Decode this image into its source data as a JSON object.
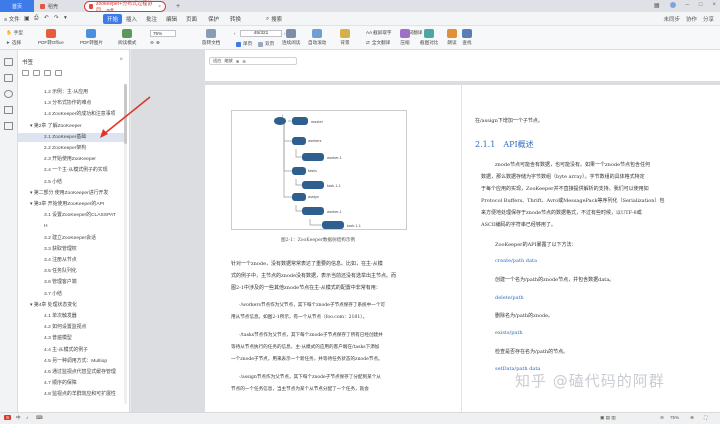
{
  "tabs": {
    "home": "首页",
    "doc": "稻壳",
    "pdf": "zookeeper+分布式过程协同....pdf",
    "add": "+"
  },
  "menu": {
    "hamburger": "≡ 文件",
    "items": [
      "开始",
      "插入",
      "批注",
      "编辑",
      "页面",
      "保护",
      "转换"
    ],
    "search": "搜索",
    "right": [
      "未同步",
      "协作",
      "分享"
    ]
  },
  "toolbar": {
    "left_small": [
      "手型",
      "选择"
    ],
    "buttons": [
      "PDF转Office",
      "PDF转图片",
      "阅读模式",
      "旋转文档",
      "单页",
      "双页",
      "连续阅读",
      "自动滚动",
      "背景",
      "全文翻译",
      "压缩",
      "截图对比",
      "朗读",
      "查找"
    ],
    "zoom": "75%",
    "page": "45",
    "page_total": "/321",
    "small_right": [
      "AA 截屏取字",
      "划词翻译"
    ]
  },
  "sidebar": {
    "title": "书签",
    "items": [
      {
        "text": "1.2 示例：主-从应用",
        "indent": 1
      },
      {
        "text": "1.3 分布式协作的难点",
        "indent": 1
      },
      {
        "text": "1.4 ZooKeeper的成功和注意事项",
        "indent": 1
      },
      {
        "text": "▾ 第2章 了解ZooKeeper",
        "indent": 0
      },
      {
        "text": "2.1 ZooKeeper基础",
        "indent": 1,
        "selected": true
      },
      {
        "text": "2.2 ZooKeeper架构",
        "indent": 1
      },
      {
        "text": "2.3 开始使用ZooKeeper",
        "indent": 1
      },
      {
        "text": "2.4 一个主-从模式例子的实现",
        "indent": 1
      },
      {
        "text": "2.5 小结",
        "indent": 1
      },
      {
        "text": "▾ 第二部分 使用ZooKeeper进行开发",
        "indent": 0
      },
      {
        "text": "▾ 第3章 开始使用ZooKeeper的API",
        "indent": 0
      },
      {
        "text": "3.1 设置ZooKeeper的CLASSPAT",
        "indent": 1
      },
      {
        "text": "H",
        "indent": 1
      },
      {
        "text": "3.2 建立ZooKeeper会话",
        "indent": 1
      },
      {
        "text": "3.3 获取管理权",
        "indent": 1
      },
      {
        "text": "3.4 注册从节点",
        "indent": 1
      },
      {
        "text": "3.5 任务队列化",
        "indent": 1
      },
      {
        "text": "3.6 管理客户端",
        "indent": 1
      },
      {
        "text": "3.7 小结",
        "indent": 1
      },
      {
        "text": "▾ 第4章 处理状态变化",
        "indent": 0
      },
      {
        "text": "4.1 单次触发器",
        "indent": 1
      },
      {
        "text": "4.2 如何设置监视点",
        "indent": 1
      },
      {
        "text": "4.3 普遍模型",
        "indent": 1
      },
      {
        "text": "4.4 主-从模式的例子",
        "indent": 1
      },
      {
        "text": "4.5 另一种调用方式：Multiop",
        "indent": 1
      },
      {
        "text": "4.6 通过监视点代替显式缓存管理",
        "indent": 1
      },
      {
        "text": "4.7 顺序的保障",
        "indent": 1
      },
      {
        "text": "4.8 监视点的羊群效应和可扩展性",
        "indent": 1
      }
    ]
  },
  "float_toolbar": [
    "适应",
    "缩放",
    "⊕",
    "⊖"
  ],
  "figure": {
    "nodes": [
      "/",
      "master",
      "workers",
      "worker-1",
      "tasks",
      "task-1-1",
      "assign",
      "worker-1",
      "task-1-1"
    ],
    "caption": "图2-1：ZooKeeper数据树结构示例"
  },
  "page_left": {
    "lines": [
      "针对一个znode，没有数据常常表达了重要的信息。比如，在主-从模",
      "式的例子中，主节点的znode没有数据，表示当前还没有选举出主节点。而",
      "图2-1中涉及的一些其他znode节点在主-从模式的配置中非常有用：",
      "·/workers节点作为父节点，其下每个znode子节点保存了系统中一个可",
      "用从节点信息。如图2-1所示，有一个从节点（foo.com：2181）。",
      "·/tasks节点作为父节点，其下每个znode子节点保存了所有已经创建并",
      "等待从节点执行的任务的信息，主-从模式的应用的客户端在/tasks下添加",
      "一个znode子节点，用来表示一个新任务，并等待任务状态的znode节点。",
      "·/assign节点作为父节点，其下每个znode子节点保存了分配到某个从",
      "节点的一个任务信息，当主节点为某个从节点分配了一个任务，就会"
    ]
  },
  "page_right": {
    "lines": [
      "在/assign下增加一个子节点。",
      "2.1.1　API概述",
      "znode节点可能含有数据，也可能没有。如果一个znode节点包含任何",
      "数据，那么数据存储为字节数组（byte array）。字节数组的具体格式特定",
      "于每个应用的实现，ZooKeeper并不直接提供解析的支持。我们可以使用如",
      "Protocol Buffers、Thrift、Avro或MessagePack等序列化（Serialization）包",
      "来方便地处理保存于znode节点的数据格式，不过有些时候，以UTF-8或",
      "ASCII编码的字符串已经够用了。",
      "ZooKeeper的API暴露了以下方法：",
      "create/path data",
      "创建一个名为/path的znode节点，并包含数据data。",
      "delete/path",
      "删除名为/path的znode。",
      "exists/path",
      "检查是否存在名为/path的节点。",
      "setData/path data"
    ]
  },
  "watermark": "知乎 @磕代码的阿群",
  "statusbar": {
    "left": [
      "S",
      "中",
      "♪",
      "⌨"
    ],
    "zoom": "75%",
    "right": [
      "⊖",
      "⊕",
      "⛶"
    ]
  },
  "colors": {
    "accent": "#3c7be8",
    "tab_highlight": "#d23c3c",
    "annotation": "#e0352b",
    "link_blue": "#2f6cc1",
    "node_fill": "#2f5f8f"
  }
}
